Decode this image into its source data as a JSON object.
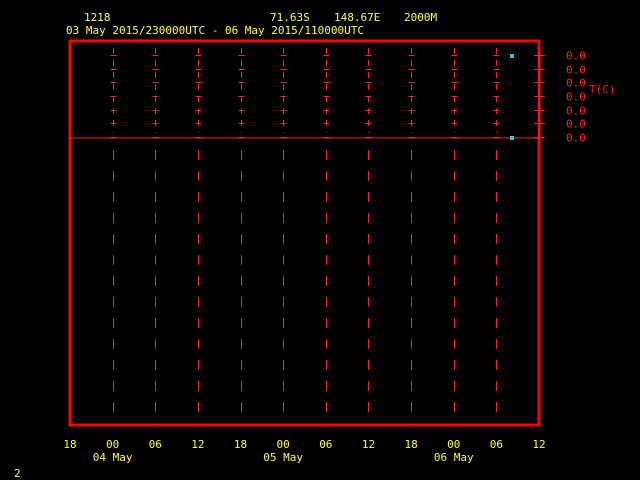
{
  "header": {
    "station_id": "1218",
    "latitude": "71.63S",
    "longitude": "148.67E",
    "level": "2000M",
    "time_range": "03 May 2015/230000UTC - 06 May 2015/110000UTC"
  },
  "footer": {
    "frame_number": "2"
  },
  "colors": {
    "background": "#000000",
    "frame": "#ff0000",
    "grid": "#ff2020",
    "header_text": "#ffff33",
    "marker": "#33cccc"
  },
  "chart_data": {
    "type": "line",
    "title": "",
    "ylabel": "T(C)",
    "xlabel": "",
    "grid": true,
    "x_tick_labels": [
      "18",
      "00",
      "06",
      "12",
      "18",
      "00",
      "06",
      "12",
      "18",
      "00",
      "06",
      "12"
    ],
    "x_date_labels": [
      {
        "label": "04 May",
        "at_tick": 1
      },
      {
        "label": "05 May",
        "at_tick": 5
      },
      {
        "label": "06 May",
        "at_tick": 9
      }
    ],
    "y_tick_labels": [
      "0.0",
      "0.0",
      "0.0",
      "0.0",
      "0.0",
      "0.0",
      "0.0"
    ],
    "series": [
      {
        "x": [
          "06 May 2015 08:00",
          "06 May 2015 08:00"
        ],
        "values": [
          0.0,
          0.0
        ]
      }
    ]
  }
}
